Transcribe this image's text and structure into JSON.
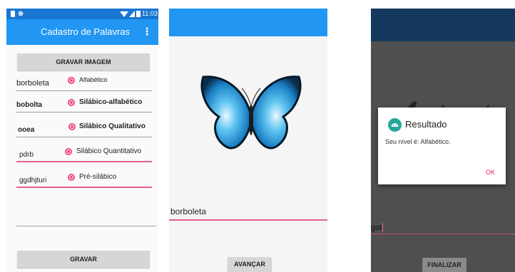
{
  "colors": {
    "primary": "#2196f3",
    "primary_dark": "#1976d2",
    "accent": "#f04a7c",
    "dialog_appbar": "#14385e",
    "dialog_ok": "#e91e63"
  },
  "screen1": {
    "status_time": "11:03",
    "title": "Cadastro de Palavras",
    "more_icon": "more-vert-icon",
    "record_image_button": "GRAVAR IMAGEM",
    "rows": [
      {
        "word": "borboleta",
        "level": "Alfabético"
      },
      {
        "word": "bobolta",
        "level": "Silábico-alfabético"
      },
      {
        "word": "ooea",
        "level": "Silábico Qualitativo"
      },
      {
        "word": "pdrb",
        "level": "Silábico Quantitativo"
      },
      {
        "word": "ggdhjturi",
        "level": "Pré-silábico"
      }
    ],
    "save_button": "GRAVAR"
  },
  "screen2": {
    "image": "butterfly",
    "input_value": "borboleta",
    "next_button": "AVANÇAR"
  },
  "screen3": {
    "image": "cat",
    "dialog": {
      "icon": "android-icon",
      "title": "Resultado",
      "message": "Seu nível é: Alfabético.",
      "ok": "OK"
    },
    "input_value": "got",
    "finish_button": "FINALIZAR"
  }
}
